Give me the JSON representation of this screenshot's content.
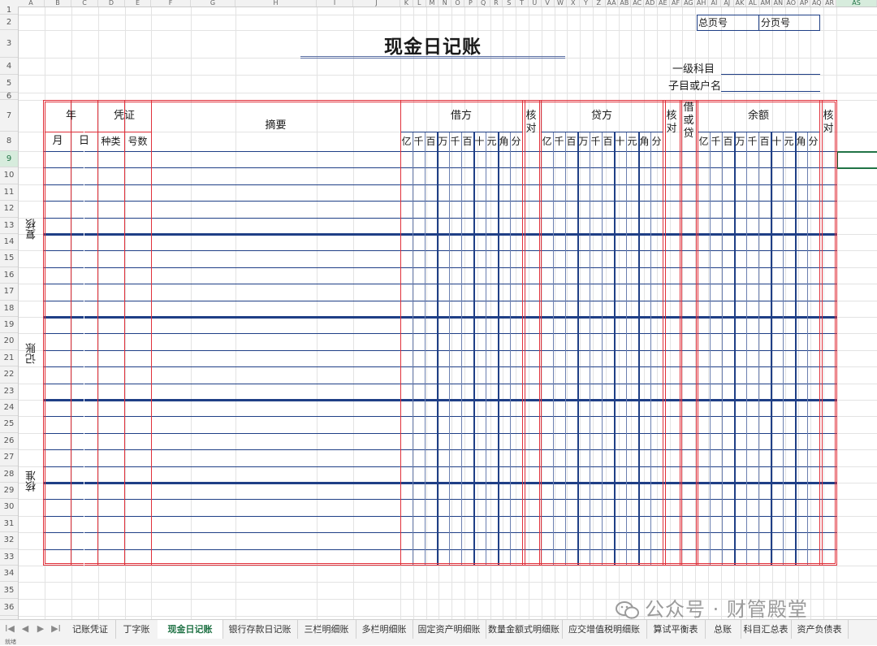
{
  "app": {
    "selected_column": "AS"
  },
  "columns": [
    "A",
    "B",
    "C",
    "D",
    "E",
    "F",
    "G",
    "H",
    "I",
    "J",
    "K",
    "L",
    "M",
    "N",
    "O",
    "P",
    "Q",
    "R",
    "S",
    "T",
    "U",
    "V",
    "W",
    "X",
    "Y",
    "Z",
    "AA",
    "AB",
    "AC",
    "AD",
    "AE",
    "AF",
    "AG",
    "AH",
    "AI",
    "AJ",
    "AK",
    "AL",
    "AM",
    "AN",
    "AO",
    "AP",
    "AQ",
    "AR",
    "AS"
  ],
  "rows": [
    "1",
    "2",
    "3",
    "4",
    "5",
    "6",
    "7",
    "8",
    "9",
    "10",
    "11",
    "12",
    "13",
    "14",
    "15",
    "16",
    "17",
    "18",
    "19",
    "20",
    "21",
    "22",
    "23",
    "24",
    "25",
    "26",
    "27",
    "28",
    "29",
    "30",
    "31",
    "32",
    "33",
    "34",
    "35",
    "36"
  ],
  "selected_row": "9",
  "form": {
    "title": "现金日记账",
    "total_page_label": "总页号",
    "sub_page_label": "分页号",
    "account_label": "一级科目",
    "subaccount_label": "子目或户名",
    "side_labels": [
      "复核",
      "记账",
      "核准"
    ],
    "header": {
      "year": "年",
      "voucher": "凭证",
      "month": "月",
      "day": "日",
      "voucher_type": "种类",
      "voucher_no": "号数",
      "summary": "摘要",
      "debit": "借方",
      "credit": "贷方",
      "balance": "余额",
      "check": "核对",
      "dc": "借或贷",
      "digits": [
        "亿",
        "千",
        "百",
        "万",
        "千",
        "百",
        "十",
        "元",
        "角",
        "分"
      ]
    }
  },
  "tabs": [
    "记账凭证",
    "丁字账",
    "现金日记账",
    "银行存款日记账",
    "三栏明细账",
    "多栏明细账",
    "固定资产明细账",
    "数量金额式明细账",
    "应交增值税明细账",
    "算试平衡表",
    "总账",
    "科目汇总表",
    "资产负债表"
  ],
  "active_tab": "现金日记账",
  "nav_icons": [
    "first-sheet-icon",
    "prev-sheet-icon",
    "next-sheet-icon",
    "last-sheet-icon"
  ],
  "nav_glyphs": [
    "I◀",
    "◀",
    "▶",
    "▶I"
  ],
  "status_text": "就绪",
  "watermark": "公众号 · 财管殿堂",
  "colors": {
    "red": "#e0303a",
    "blue": "#1f3f86",
    "accent": "#217346"
  }
}
